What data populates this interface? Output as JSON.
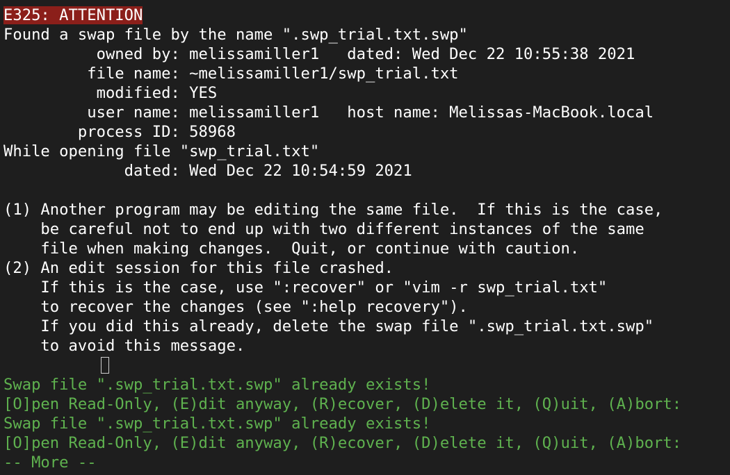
{
  "terminal": {
    "error_tag": "E325: ATTENTION",
    "lines": [
      "Found a swap file by the name \".swp_trial.txt.swp\"",
      "          owned by: melissamiller1   dated: Wed Dec 22 10:55:38 2021",
      "         file name: ~melissamiller1/swp_trial.txt",
      "          modified: YES",
      "         user name: melissamiller1   host name: Melissas-MacBook.local",
      "        process ID: 58968",
      "While opening file \"swp_trial.txt\"",
      "             dated: Wed Dec 22 10:54:59 2021",
      "",
      "(1) Another program may be editing the same file.  If this is the case,",
      "    be careful not to end up with two different instances of the same",
      "    file when making changes.  Quit, or continue with caution.",
      "(2) An edit session for this file crashed.",
      "    If this is the case, use \":recover\" or \"vim -r swp_trial.txt\"",
      "    to recover the changes (see \":help recovery\").",
      "    If you did this already, delete the swap file \".swp_trial.txt.swp\"",
      "    to avoid this message."
    ],
    "prompts": [
      "Swap file \".swp_trial.txt.swp\" already exists!",
      "[O]pen Read-Only, (E)dit anyway, (R)ecover, (D)elete it, (Q)uit, (A)bort:",
      "Swap file \".swp_trial.txt.swp\" already exists!",
      "[O]pen Read-Only, (E)dit anyway, (R)ecover, (D)elete it, (Q)uit, (A)bort:",
      "-- More --"
    ],
    "colors": {
      "background": "#1e1e1e",
      "text": "#ffffff",
      "error_background": "#8b1f1a",
      "prompt_green": "#5fb24f"
    }
  }
}
